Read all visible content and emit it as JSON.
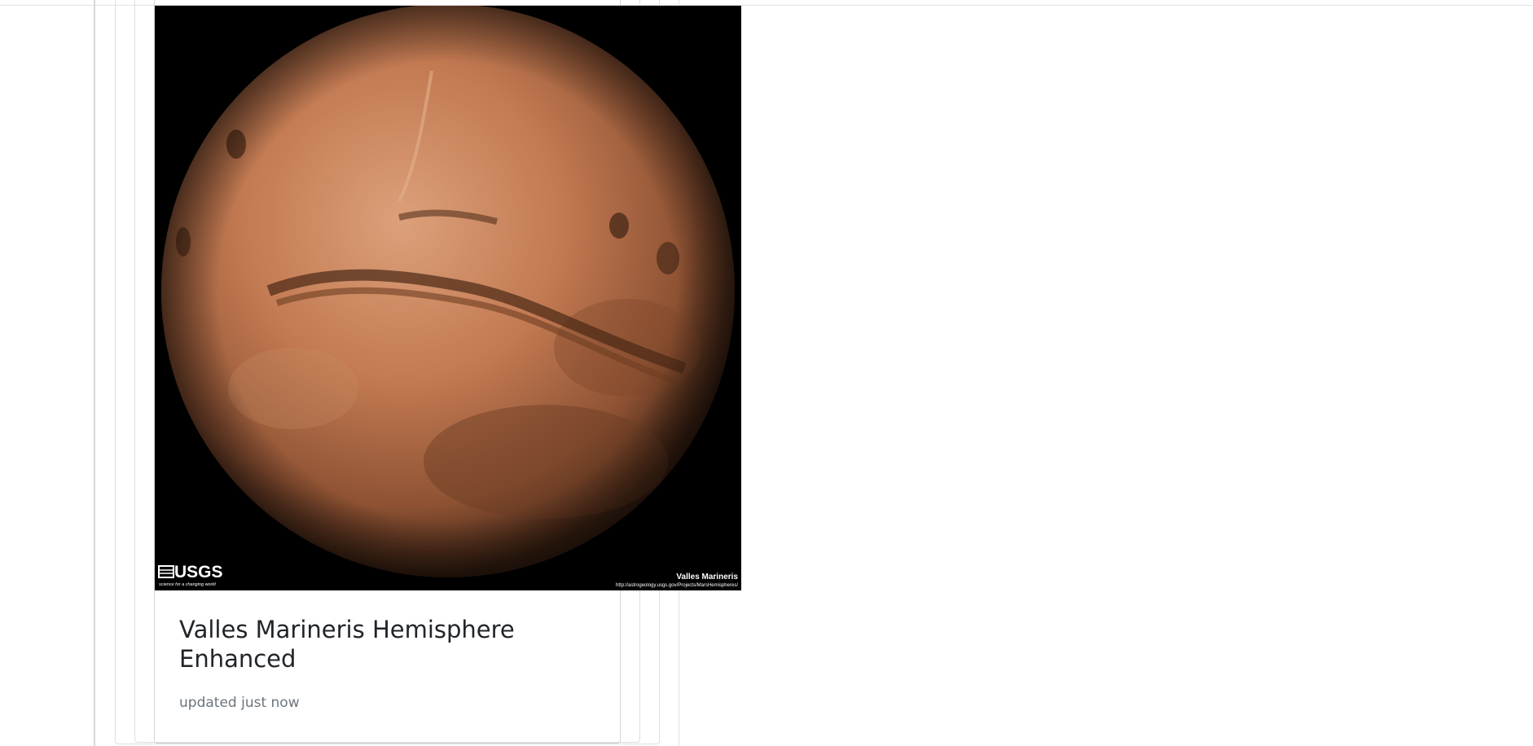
{
  "card": {
    "title": "Valles Marineris Hemisphere Enhanced",
    "updated": "updated just now",
    "image": {
      "logo_text": "USGS",
      "logo_tagline": "science for a changing world",
      "caption_title": "Valles Marineris",
      "caption_url": "http://astrogeology.usgs.gov/Projects/MarsHemispheres/"
    }
  },
  "colors": {
    "background": "#ffffff",
    "title": "#212529",
    "muted": "#6c757d",
    "border": "#dedede",
    "image_bg": "#000000",
    "planet_light": "#d9966c",
    "planet_mid": "#b8714a",
    "planet_dark": "#5a3420"
  }
}
